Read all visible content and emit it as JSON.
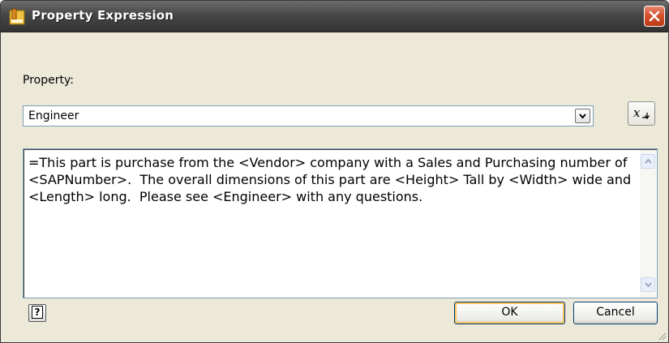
{
  "window": {
    "title": "Property Expression",
    "icon": "inventor-app-icon",
    "close_icon": "close-icon"
  },
  "property": {
    "label": "Property:",
    "selected": "Engineer",
    "insert_button_icon": "insert-parameter-icon",
    "insert_button_text": "x"
  },
  "expression": {
    "value": "=This part is purchase from the <Vendor> company with a Sales and Purchasing number of <SAPNumber>.  The overall dimensions of this part are <Height> Tall by <Width> wide and <Length> long.  Please see <Engineer> with any questions."
  },
  "footer": {
    "help_glyph": "?",
    "ok_label": "OK",
    "cancel_label": "Cancel"
  },
  "colors": {
    "titlebar": "#474747",
    "close_button": "#d3532e",
    "dialog_bg": "#ece9d8",
    "default_button_highlight": "#f7c261"
  }
}
